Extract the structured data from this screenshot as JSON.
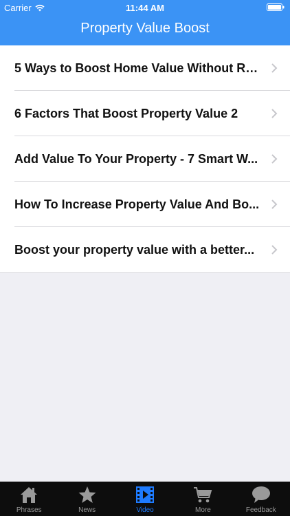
{
  "status_bar": {
    "carrier": "Carrier",
    "time": "11:44 AM"
  },
  "nav": {
    "title": "Property Value Boost"
  },
  "list": {
    "items": [
      {
        "label": "5 Ways to Boost Home Value Without Re..."
      },
      {
        "label": "6 Factors That Boost Property Value 2"
      },
      {
        "label": "Add Value To Your Property - 7 Smart W..."
      },
      {
        "label": "How To Increase Property Value And Bo..."
      },
      {
        "label": "Boost your property value with a better..."
      }
    ]
  },
  "tabbar": {
    "tabs": [
      {
        "label": "Phrases",
        "icon": "house-icon"
      },
      {
        "label": "News",
        "icon": "star-icon"
      },
      {
        "label": "Video",
        "icon": "film-icon",
        "active": true
      },
      {
        "label": "More",
        "icon": "cart-icon"
      },
      {
        "label": "Feedback",
        "icon": "chat-bubble-icon"
      }
    ]
  },
  "colors": {
    "nav_blue": "#3b93f5",
    "active_tab": "#1e7bff",
    "tab_bg": "#0d0d0d",
    "inactive_tab": "#9a9a9a"
  }
}
